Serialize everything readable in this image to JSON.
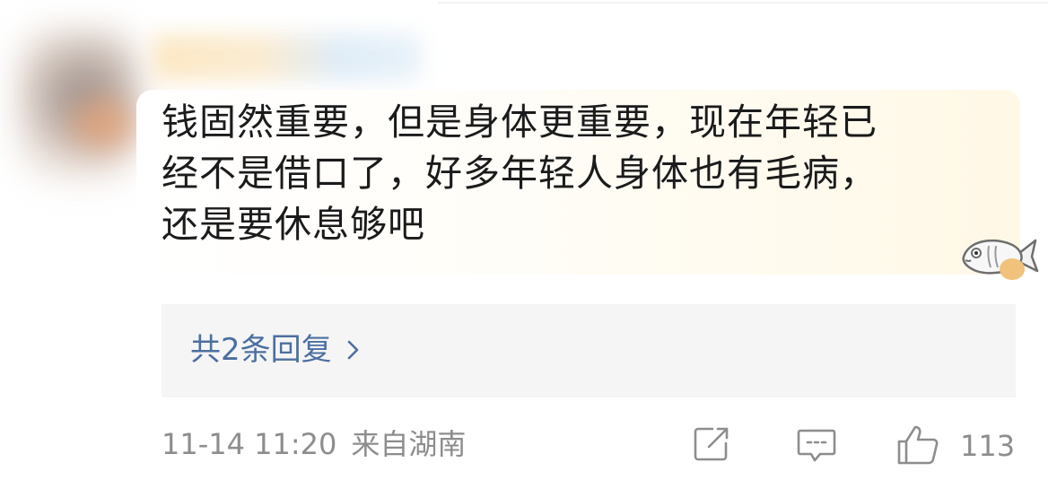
{
  "comment": {
    "text_lines": [
      "钱固然重要，但是身体更重要，现在年轻已",
      "经不是借口了，好多年轻人身体也有毛病，",
      "还是要休息够吧"
    ]
  },
  "replies": {
    "label": "共2条回复"
  },
  "footer": {
    "timestamp": "11-14 11:20",
    "location": "来自湖南",
    "like_count": "113"
  },
  "colors": {
    "text": "#1b1b1b",
    "link": "#4c6fa0",
    "meta": "#8d8d8d",
    "replies_bg": "#f5f5f5"
  },
  "icons": {
    "share": "share-icon",
    "comment": "comment-icon",
    "like": "thumbs-up-icon",
    "replies_chevron": "chevron-right-icon",
    "sticker": "fish-sticker-icon"
  }
}
